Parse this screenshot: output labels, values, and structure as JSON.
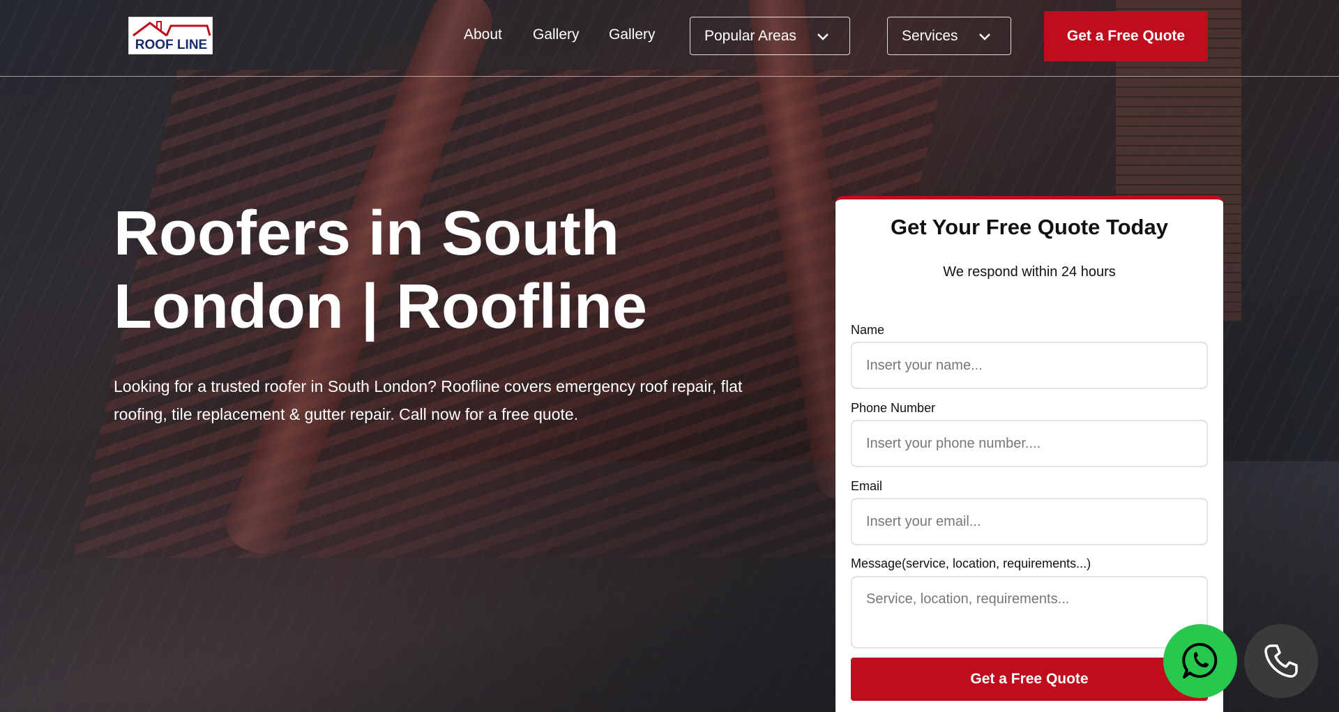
{
  "header": {
    "logo_text": "ROOF LINE",
    "nav": {
      "about": "About",
      "gallery_1": "Gallery",
      "gallery_2": "Gallery",
      "popular_areas": "Popular Areas",
      "services": "Services"
    },
    "cta_label": "Get a Free Quote"
  },
  "hero": {
    "title_line1": "Roofers in South",
    "title_line2": "London | Roofline",
    "description": "Looking for a trusted roofer in South London? Roofline covers emergency roof repair, flat roofing, tile replacement & gutter repair. Call now for a free quote."
  },
  "quote_form": {
    "title": "Get Your Free Quote Today",
    "subtitle": "We respond within 24 hours",
    "name_label": "Name",
    "name_placeholder": "Insert your name...",
    "phone_label": "Phone Number",
    "phone_placeholder": "Insert your phone number....",
    "email_label": "Email",
    "email_placeholder": "Insert your email...",
    "message_label": "Message(service, location, requirements...)",
    "message_placeholder": "Service, location, requirements...",
    "submit_label": "Get a Free Quote"
  },
  "floating_buttons": {
    "whatsapp_icon": "whatsapp-icon",
    "phone_icon": "phone-icon"
  },
  "colors": {
    "brand_red": "#c00d1e",
    "whatsapp_green": "#26c94e",
    "logo_navy": "#1a2a6c"
  }
}
